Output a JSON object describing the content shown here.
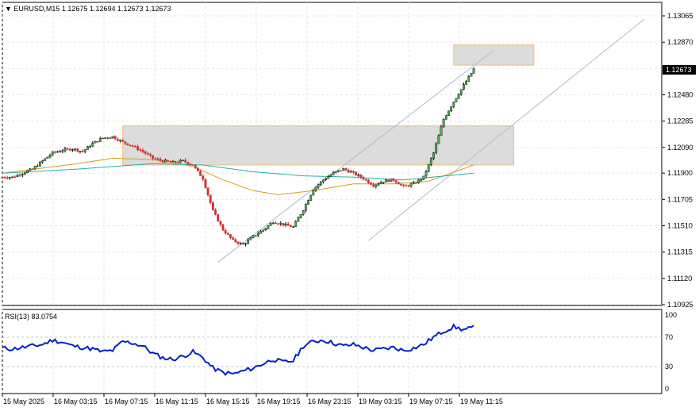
{
  "header": {
    "symbol_line": "▼ EURUSD,M15  1.12675 1.12694 1.12673 1.12673"
  },
  "rsi_label": "RSI(13) 83.0754",
  "current_price_label": "1.12673",
  "chart_data": [
    {
      "type": "candlestick",
      "symbol": "EURUSD",
      "timeframe": "M15",
      "ohlc_header": {
        "open": 1.12675,
        "high": 1.12694,
        "low": 1.12673,
        "close": 1.12673
      },
      "ylim": [
        1.10925,
        1.13065
      ],
      "y_ticks": [
        "1.13065",
        "1.12870",
        "1.12673",
        "1.12480",
        "1.12285",
        "1.12090",
        "1.11900",
        "1.11705",
        "1.11510",
        "1.11315",
        "1.11120",
        "1.10925"
      ],
      "x_ticks": [
        "15 May 2025",
        "16 May 03:15",
        "16 May 07:15",
        "16 May 11:15",
        "16 May 15:15",
        "16 May 19:15",
        "16 May 23:15",
        "19 May 03:15",
        "19 May 07:15",
        "19 May 11:15"
      ],
      "close_path": [
        [
          0,
          1.1187
        ],
        [
          4,
          1.1187
        ],
        [
          8,
          1.119
        ],
        [
          12,
          1.1193
        ],
        [
          16,
          1.1199
        ],
        [
          20,
          1.1205
        ],
        [
          24,
          1.1207
        ],
        [
          28,
          1.1208
        ],
        [
          32,
          1.1206
        ],
        [
          36,
          1.1212
        ],
        [
          40,
          1.1216
        ],
        [
          44,
          1.1217
        ],
        [
          48,
          1.1213
        ],
        [
          52,
          1.121
        ],
        [
          56,
          1.1206
        ],
        [
          60,
          1.1201
        ],
        [
          64,
          1.1199
        ],
        [
          68,
          1.1198
        ],
        [
          72,
          1.1199
        ],
        [
          76,
          1.1196
        ],
        [
          80,
          1.1186
        ],
        [
          84,
          1.1162
        ],
        [
          88,
          1.1148
        ],
        [
          92,
          1.114
        ],
        [
          96,
          1.1137
        ],
        [
          100,
          1.1143
        ],
        [
          104,
          1.1148
        ],
        [
          108,
          1.1154
        ],
        [
          112,
          1.1152
        ],
        [
          116,
          1.115
        ],
        [
          120,
          1.1163
        ],
        [
          124,
          1.1178
        ],
        [
          128,
          1.1185
        ],
        [
          132,
          1.119
        ],
        [
          136,
          1.1193
        ],
        [
          140,
          1.119
        ],
        [
          144,
          1.1186
        ],
        [
          148,
          1.1181
        ],
        [
          152,
          1.1184
        ],
        [
          156,
          1.1185
        ],
        [
          160,
          1.118
        ],
        [
          164,
          1.1182
        ],
        [
          168,
          1.1187
        ],
        [
          172,
          1.1205
        ],
        [
          176,
          1.123
        ],
        [
          180,
          1.1243
        ],
        [
          184,
          1.1255
        ],
        [
          188,
          1.1267
        ]
      ],
      "moving_averages": [
        {
          "color": "#d4a017",
          "path": [
            [
              0,
              1.119
            ],
            [
              30,
              1.1197
            ],
            [
              44,
              1.1201
            ],
            [
              60,
              1.12
            ],
            [
              76,
              1.1195
            ],
            [
              88,
              1.1185
            ],
            [
              100,
              1.1177
            ],
            [
              110,
              1.1174
            ],
            [
              124,
              1.1177
            ],
            [
              140,
              1.1182
            ],
            [
              156,
              1.1182
            ],
            [
              170,
              1.1184
            ],
            [
              188,
              1.1196
            ]
          ]
        },
        {
          "color": "#20b2aa",
          "path": [
            [
              0,
              1.119
            ],
            [
              30,
              1.1193
            ],
            [
              60,
              1.1197
            ],
            [
              80,
              1.1196
            ],
            [
              100,
              1.1191
            ],
            [
              120,
              1.1188
            ],
            [
              140,
              1.1187
            ],
            [
              160,
              1.1185
            ],
            [
              188,
              1.119
            ]
          ]
        }
      ],
      "zones": [
        {
          "x": [
            180,
            212
          ],
          "y": [
            1.127,
            1.1285
          ],
          "border": "#f0c070",
          "fill": "#dcdcdc"
        },
        {
          "x": [
            48,
            204
          ],
          "y": [
            1.1196,
            1.1225
          ],
          "border": "#f0c070",
          "fill": "#dcdcdc"
        }
      ],
      "trend_lines": [
        {
          "color": "#a9bcc9",
          "from": [
            86,
            1.1124
          ],
          "to": [
            196,
            1.1281
          ]
        },
        {
          "color": "#a9bcc9",
          "from": [
            146,
            1.114
          ],
          "to": [
            256,
            1.1304
          ]
        }
      ],
      "indicator": {
        "name": "RSI(13)",
        "value": 83.0754,
        "ylim": [
          0,
          100
        ],
        "y_ticks": [
          100,
          70,
          30,
          0
        ],
        "levels": [
          70,
          30
        ],
        "color": "#0020d0",
        "values": [
          [
            0,
            55
          ],
          [
            4,
            54
          ],
          [
            8,
            56
          ],
          [
            12,
            58
          ],
          [
            16,
            60
          ],
          [
            20,
            66
          ],
          [
            24,
            63
          ],
          [
            28,
            58
          ],
          [
            32,
            56
          ],
          [
            36,
            54
          ],
          [
            40,
            50
          ],
          [
            44,
            52
          ],
          [
            48,
            64
          ],
          [
            52,
            62
          ],
          [
            56,
            58
          ],
          [
            60,
            48
          ],
          [
            64,
            42
          ],
          [
            68,
            40
          ],
          [
            72,
            44
          ],
          [
            76,
            50
          ],
          [
            80,
            42
          ],
          [
            84,
            28
          ],
          [
            88,
            22
          ],
          [
            92,
            20
          ],
          [
            96,
            24
          ],
          [
            100,
            28
          ],
          [
            104,
            34
          ],
          [
            108,
            40
          ],
          [
            112,
            36
          ],
          [
            116,
            38
          ],
          [
            120,
            58
          ],
          [
            124,
            64
          ],
          [
            128,
            66
          ],
          [
            132,
            62
          ],
          [
            136,
            58
          ],
          [
            140,
            60
          ],
          [
            144,
            56
          ],
          [
            148,
            52
          ],
          [
            152,
            54
          ],
          [
            156,
            56
          ],
          [
            160,
            52
          ],
          [
            164,
            55
          ],
          [
            168,
            60
          ],
          [
            172,
            70
          ],
          [
            176,
            78
          ],
          [
            180,
            84
          ],
          [
            184,
            80
          ],
          [
            188,
            83
          ]
        ]
      }
    }
  ]
}
